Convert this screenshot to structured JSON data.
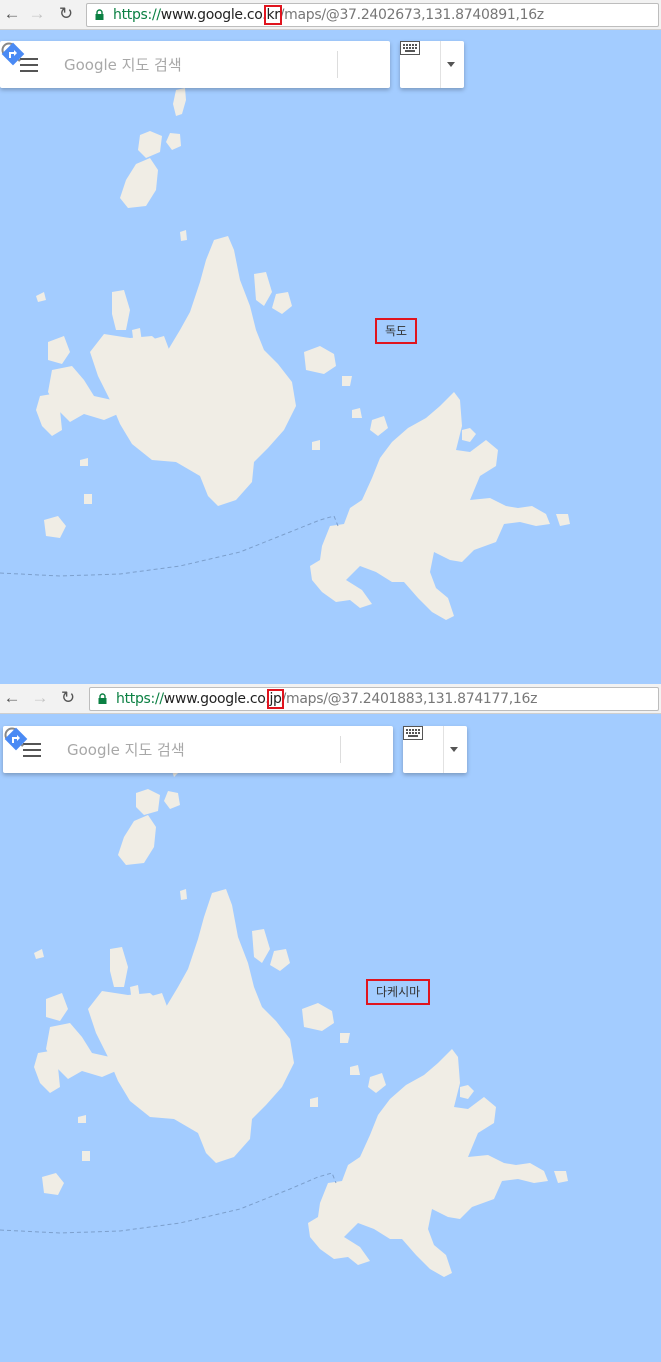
{
  "screens": [
    {
      "url": {
        "scheme": "https://",
        "host": "www.google.co",
        "tld_dot": ".",
        "tld": "kr",
        "rest": "/maps/@37.2402673,131.8740891,16z"
      },
      "search_placeholder": "Google 지도 검색",
      "place_label": "독도"
    },
    {
      "url": {
        "scheme": "https://",
        "host": "www.google.co",
        "tld_dot": ".",
        "tld": "jp",
        "rest": "/maps/@37.2401883,131.874177,16z"
      },
      "search_placeholder": "Google 지도 검색",
      "place_label": "다케시마"
    }
  ],
  "icons": {
    "back": "back-arrow-icon",
    "forward": "forward-arrow-icon",
    "reload": "reload-icon",
    "lock": "lock-icon",
    "menu": "menu-icon",
    "search": "search-icon",
    "directions": "directions-icon",
    "keyboard": "keyboard-icon",
    "dropdown": "chevron-down-icon"
  },
  "colors": {
    "water": "#a3ccff",
    "land": "#f0ede5",
    "highlight": "#e0141e",
    "directions": "#4a8af4",
    "secure": "#0b8043"
  }
}
